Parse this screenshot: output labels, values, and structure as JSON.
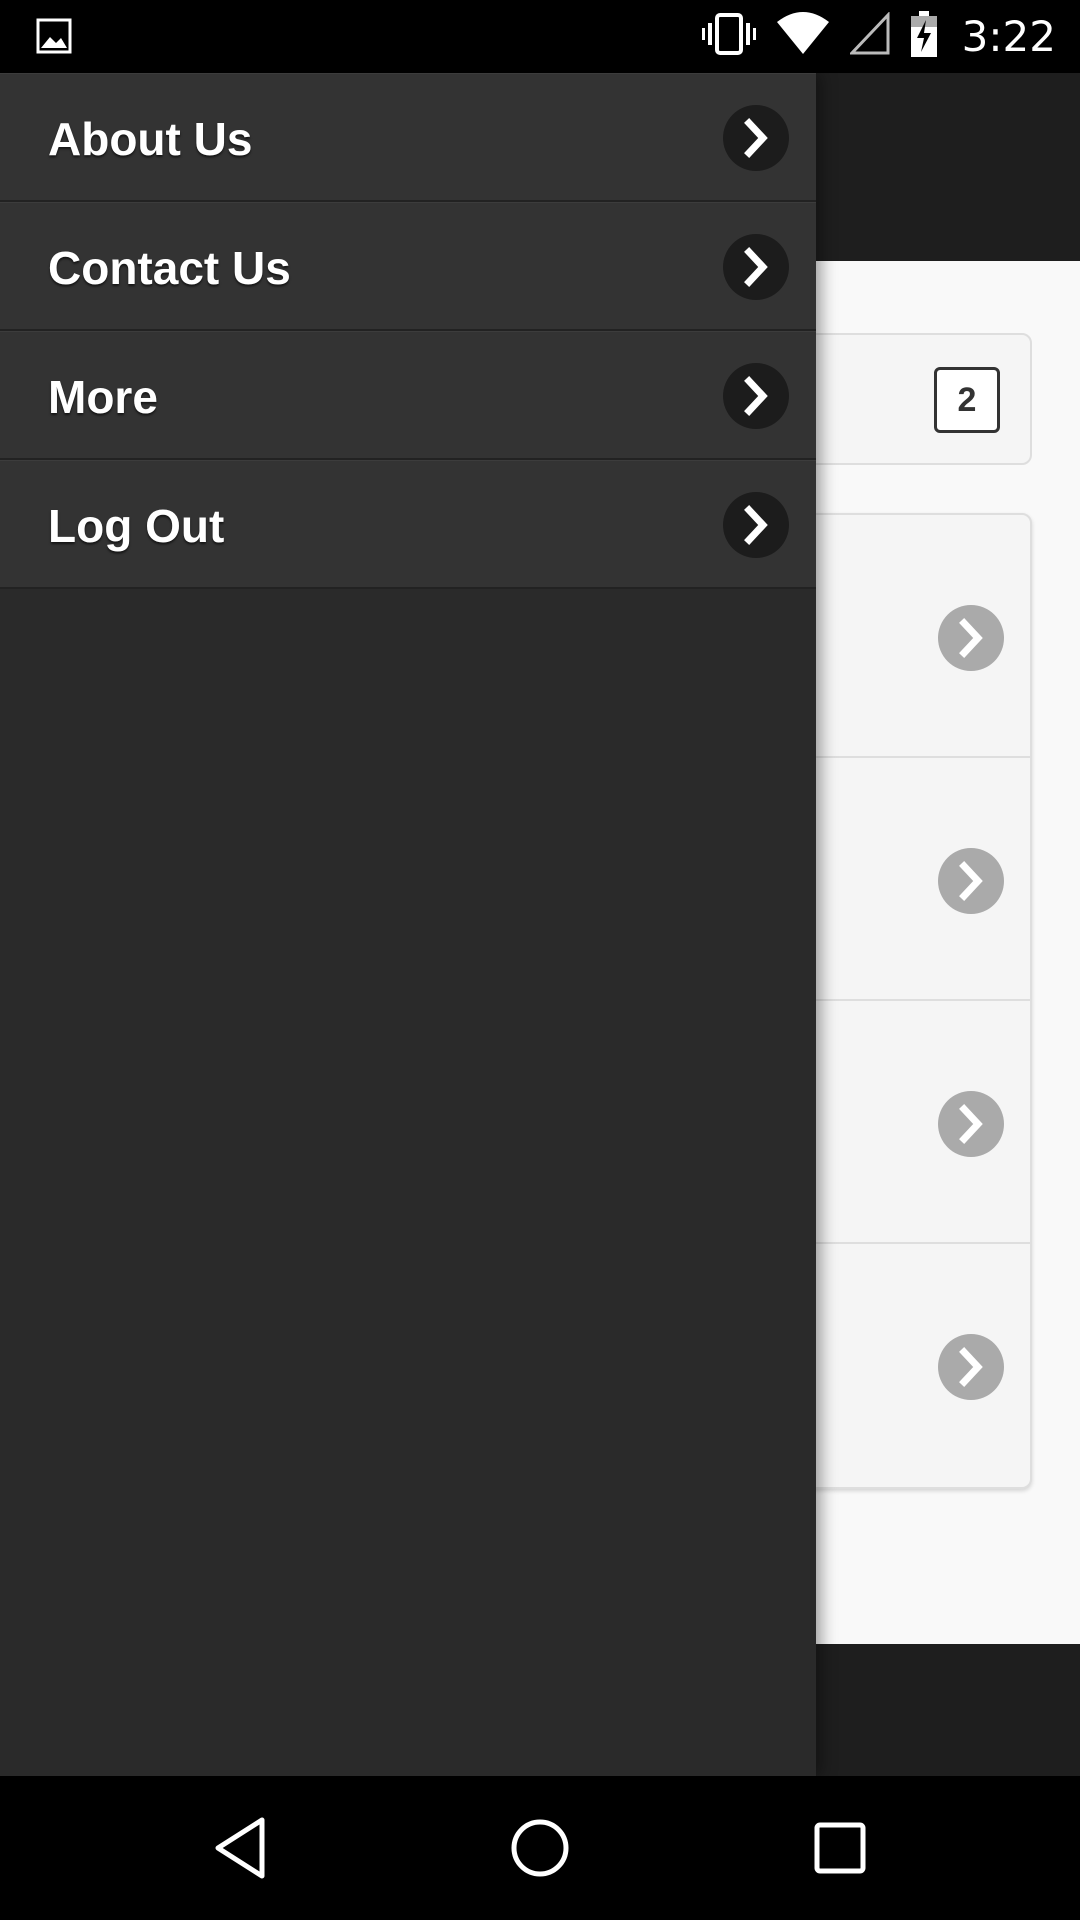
{
  "status_bar": {
    "time": "3:22",
    "icons": [
      "image-notification-icon",
      "vibrate-icon",
      "wifi-icon",
      "cell-signal-icon",
      "battery-charging-icon"
    ]
  },
  "content": {
    "count_badge": "2"
  },
  "drawer": {
    "items": [
      {
        "label": "About Us"
      },
      {
        "label": "Contact Us"
      },
      {
        "label": "More"
      },
      {
        "label": "Log Out"
      }
    ]
  },
  "nav_bar": {
    "icons": [
      "back-icon",
      "home-icon",
      "recents-icon"
    ]
  },
  "colors": {
    "drawer_bg": "#2a2a2a",
    "menu_item_bg": "#333333",
    "header_bg": "#1e1e1e",
    "content_bg": "#f9f9f9",
    "chevron_gray": "#aaaaaa"
  }
}
